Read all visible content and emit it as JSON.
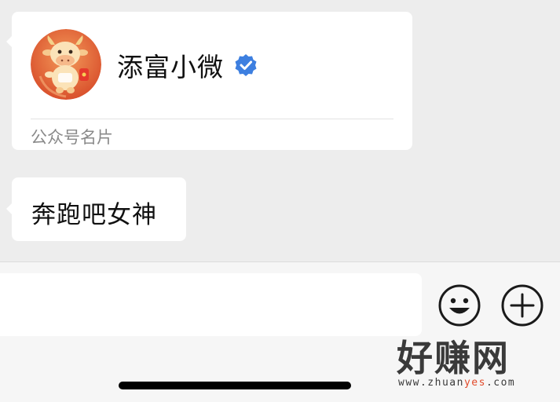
{
  "chat": {
    "card": {
      "account_name": "添富小微",
      "card_type_label": "公众号名片",
      "avatar_icon": "cartoon-ox-avatar-icon",
      "verified_icon": "verified-badge-icon",
      "colors": {
        "verified": "#3d7fe0",
        "avatar_bg": "#e8683a"
      }
    },
    "message": {
      "text": "奔跑吧女神"
    }
  },
  "input_bar": {
    "input_value": "",
    "emoji_icon": "smiley-face-icon",
    "more_icon": "plus-circle-icon"
  },
  "watermark": {
    "title": "好赚网",
    "url_prefix": "www.zhuan",
    "url_accent": "yes",
    "url_suffix": ".com",
    "accent_color": "#e24a2a"
  }
}
